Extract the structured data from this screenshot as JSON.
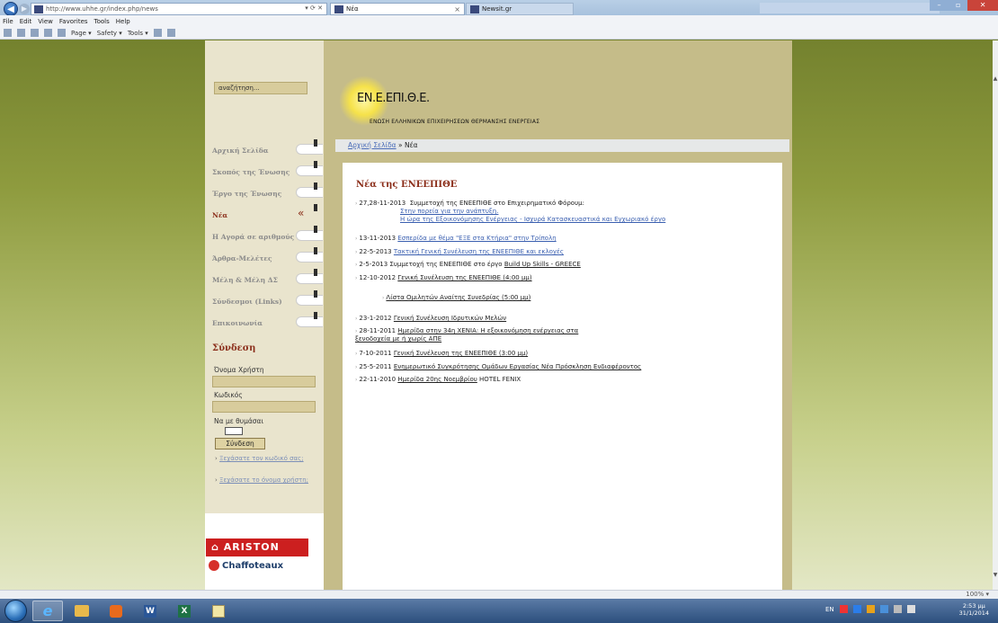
{
  "browser": {
    "url": "http://www.uhhe.gr/index.php/news",
    "address_controls": "▾ ⟳ ✕",
    "tabs": [
      {
        "label": "Νέα"
      },
      {
        "label": "Newsit.gr"
      }
    ],
    "tab_close": "×",
    "right_icons": "⌂ ★ ⚙",
    "menu": [
      "File",
      "Edit",
      "View",
      "Favorites",
      "Tools",
      "Help"
    ],
    "commands": [
      "Page ▾",
      "Safety ▾",
      "Tools ▾"
    ],
    "zoom": "100%"
  },
  "site": {
    "logo_title": "ΕΝ.Ε.ΕΠΙ.Θ.Ε.",
    "logo_subtitle": "ΕΝΩΣΗ ΕΛΛΗΝΙΚΩΝ ΕΠΙΧΕΙΡΗΣΕΩΝ ΘΕΡΜΑΝΣΗΣ ΕΝΕΡΓΕΙΑΣ",
    "search_placeholder": "αναζήτηση...",
    "breadcrumb": {
      "home": "Αρχική Σελίδα",
      "separator": " » ",
      "current": "Νέα"
    }
  },
  "sidebar": {
    "nav": [
      {
        "label": "Αρχική Σελίδα"
      },
      {
        "label": "Σκοπός της Ένωσης"
      },
      {
        "label": "Έργο της Ένωσης"
      },
      {
        "label": "Νέα",
        "active": true,
        "active_mark": "«"
      },
      {
        "label": "Η Αγορά σε αριθμούς"
      },
      {
        "label": "Άρθρα-Μελέτες"
      },
      {
        "label": "Μέλη & Μέλη ΔΣ"
      },
      {
        "label": "Σύνδεσμοι (Links)"
      },
      {
        "label": "Επικοινωνία"
      }
    ],
    "login": {
      "title": "Σύνδεση",
      "username_label": "Όνομα Χρήστη",
      "password_label": "Κωδικός",
      "remember_label": "Να με θυμάσαι",
      "button": "Σύνδεση",
      "forgot_password": "Ξεχάσατε τον κωδικό σας;",
      "forgot_username": "Ξεχάσατε το όνομα χρήστη;"
    },
    "ads": {
      "ariston": "ARISTON",
      "chaffoteaux": "Chaffoteaux"
    }
  },
  "main": {
    "title": "Νέα της ΕΝΕΕΠΙΘΕ",
    "news": [
      {
        "date": "27,28-11-2013",
        "text": "Συμμετοχή της ΕΝΕΕΠΙΘΕ στο Επιχειρηματικό Φόρουμ:",
        "links": [
          "Στην πορεία για την ανάπτυξη.",
          "Η ώρα της Εξοικονόμησης Ενέργειας - Ισχυρά Κατασκευαστικά και Εγχωριακό έργο"
        ]
      },
      {
        "date": "13-11-2013",
        "link": "Εσπερίδα με θέμα \"ΕΞΕ στα Κτήρια\" στην Τρίπολη"
      },
      {
        "date": "22-5-2013",
        "link": "Τακτική Γενική Συνέλευση της ΕΝΕΕΠΙΘΕ και εκλογές"
      },
      {
        "date": "2-5-2013",
        "text": "Συμμετοχή της ΕΝΕΕΠΙΘΕ στο έργο",
        "link": "Build Up Skills - GREECE"
      },
      {
        "date": "12-10-2012",
        "link": "Γενική Συνέλευση της ΕΝΕΕΠΙΘΕ (4:00 μμ)"
      },
      {
        "sub": "Λίστα Ομιλητών Αναίτης Συνεδρίας (5:00 μμ)"
      },
      {
        "date": "23-1-2012",
        "link": "Γενική Συνέλευση Ιδρυτικών Μελών"
      },
      {
        "date": "28-11-2011",
        "link": "Ημερίδα στην 34η ΧΕΝΙΑ: Η εξοικονόμηση ενέργειας στα",
        "link2": "ξενοδοχεία με ή χωρίς ΑΠΕ"
      },
      {
        "date": "7-10-2011",
        "link": "Γενική Συνέλευση της ΕΝΕΕΠΙΘΕ (3:00 μμ)"
      },
      {
        "date": "25-5-2011",
        "link": "Ενημερωτικό Συγκρότησης Ομάδων Εργασίας Νέα Πρόσκληση Ενδιαφέροντος"
      },
      {
        "date": "22-11-2010",
        "link": "Ημερίδα 20ης Νοεμβρίου",
        "text2": "HOTEL FENIX"
      }
    ]
  },
  "taskbar": {
    "language": "EN",
    "time": "2:53 μμ",
    "date": "31/1/2014"
  }
}
